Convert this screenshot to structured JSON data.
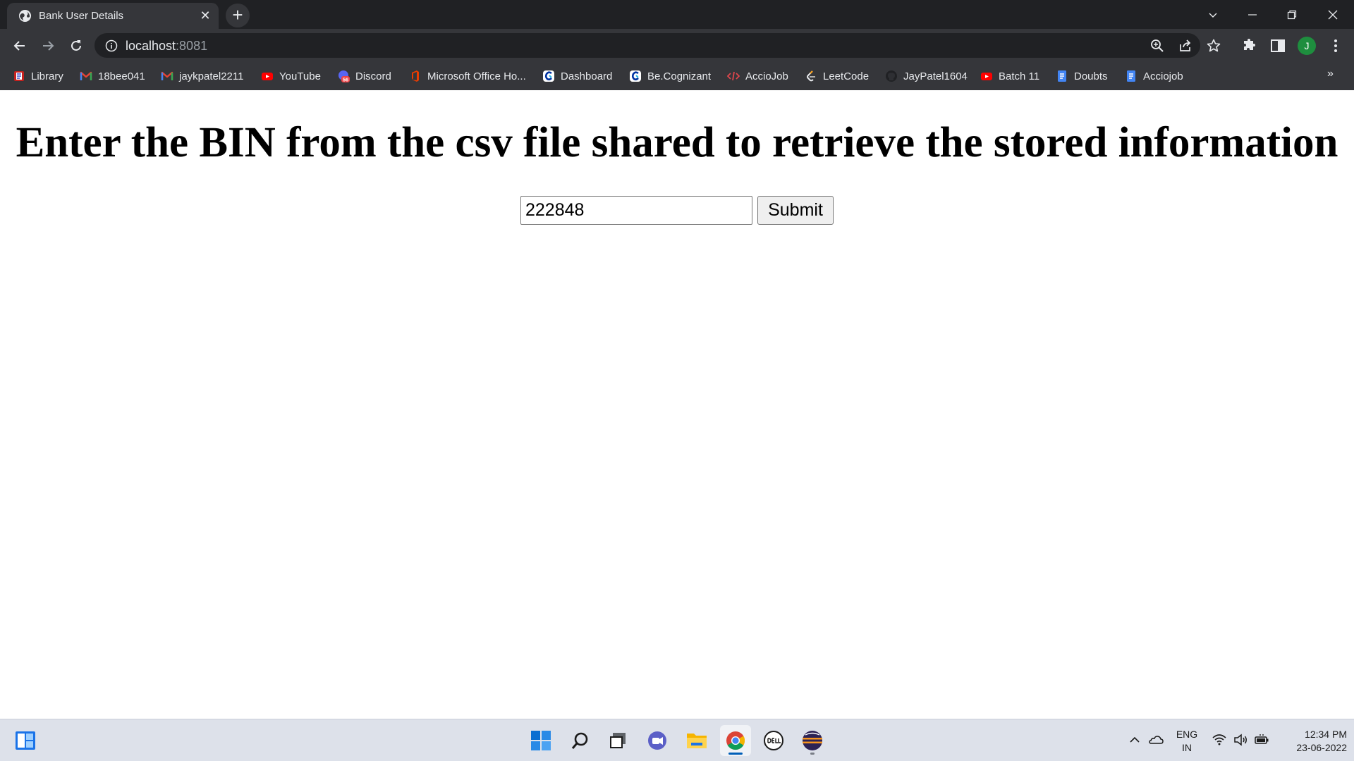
{
  "browser": {
    "tab": {
      "title": "Bank User Details"
    },
    "address": {
      "host": "localhost",
      "port": ":8081"
    },
    "profile_initial": "J",
    "bookmarks": [
      {
        "label": "Library",
        "icon": "library-icon"
      },
      {
        "label": "18bee041",
        "icon": "gmail-icon"
      },
      {
        "label": "jaykpatel2211",
        "icon": "gmail-icon"
      },
      {
        "label": "YouTube",
        "icon": "youtube-icon"
      },
      {
        "label": "Discord",
        "icon": "discord-icon",
        "badge": "56"
      },
      {
        "label": "Microsoft Office Ho...",
        "icon": "office-icon"
      },
      {
        "label": "Dashboard",
        "icon": "cognizant-icon"
      },
      {
        "label": "Be.Cognizant",
        "icon": "cognizant-icon"
      },
      {
        "label": "AccioJob",
        "icon": "code-icon"
      },
      {
        "label": "LeetCode",
        "icon": "leetcode-icon"
      },
      {
        "label": "JayPatel1604",
        "icon": "github-icon"
      },
      {
        "label": "Batch 11",
        "icon": "youtube-icon"
      },
      {
        "label": "Doubts",
        "icon": "docs-icon"
      },
      {
        "label": "Acciojob",
        "icon": "docs-icon"
      }
    ],
    "more_bookmarks": "»"
  },
  "page": {
    "heading": "Enter the BIN from the csv file shared to retrieve the stored information",
    "bin_input_value": "222848",
    "submit_label": "Submit"
  },
  "taskbar": {
    "apps": [
      "widgets-icon",
      "start-icon",
      "search-icon",
      "task-view-icon",
      "teams-chat-icon",
      "file-explorer-icon",
      "chrome-icon",
      "dell-icon",
      "eclipse-icon"
    ],
    "language": {
      "line1": "ENG",
      "line2": "IN"
    },
    "clock": {
      "time": "12:34 PM",
      "date": "23-06-2022"
    }
  },
  "colors": {
    "tabstrip": "#202124",
    "toolbar": "#35363a",
    "accent_blue": "#005fb8",
    "avatar_green": "#1e8e3e"
  }
}
